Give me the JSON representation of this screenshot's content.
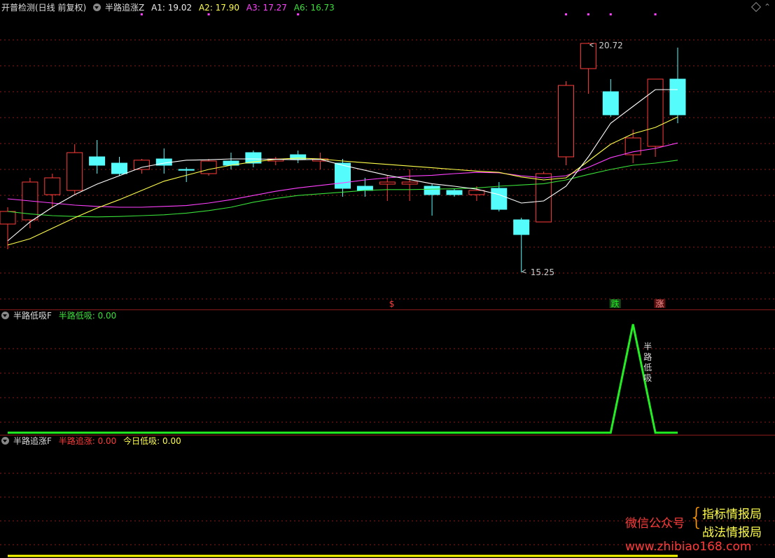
{
  "header": {
    "indicator_name": "开普检测(日线 前复权)",
    "formula_name": "半路追涨Z",
    "A1": "A1: 19.02",
    "A2": "A2: 17.90",
    "A3": "A3: 17.27",
    "A6": "A6: 16.73"
  },
  "panel2": {
    "title": "半路低吸F",
    "series_label": "半路低吸: 0.00"
  },
  "panel3": {
    "title": "半路追涨F",
    "label1": "半路追涨: 0.00",
    "label2": "今日低吸: 0.00"
  },
  "colors": {
    "up": "#ff3b3b",
    "down": "#54fcfc",
    "ma1": "#ffffff",
    "ma2": "#ffff4a",
    "ma3": "#ff40ff",
    "ma4": "#38e038",
    "grid": "#8b1a1a",
    "signal": "#22ee22",
    "yellow": "#ffff00"
  },
  "chart_data": {
    "type": "candlestick",
    "ylim": [
      14.4,
      21.4
    ],
    "annotations": {
      "high": "20.72",
      "low": "15.25"
    },
    "signal_marks": [
      "$",
      "跌",
      "涨"
    ],
    "candles": [
      {
        "o": 16.4,
        "h": 16.8,
        "l": 15.8,
        "c": 16.7
      },
      {
        "o": 16.5,
        "h": 17.5,
        "l": 16.3,
        "c": 17.4
      },
      {
        "o": 17.1,
        "h": 17.6,
        "l": 16.8,
        "c": 17.5
      },
      {
        "o": 17.2,
        "h": 18.3,
        "l": 17.1,
        "c": 18.1
      },
      {
        "o": 18.0,
        "h": 18.4,
        "l": 17.6,
        "c": 17.8
      },
      {
        "o": 17.85,
        "h": 18.0,
        "l": 17.55,
        "c": 17.6
      },
      {
        "o": 17.7,
        "h": 17.95,
        "l": 17.6,
        "c": 17.92
      },
      {
        "o": 17.95,
        "h": 18.2,
        "l": 17.6,
        "c": 17.8
      },
      {
        "o": 17.7,
        "h": 17.75,
        "l": 17.4,
        "c": 17.68
      },
      {
        "o": 17.6,
        "h": 17.95,
        "l": 17.55,
        "c": 17.9
      },
      {
        "o": 17.9,
        "h": 18.1,
        "l": 17.7,
        "c": 17.8
      },
      {
        "o": 18.1,
        "h": 18.15,
        "l": 17.75,
        "c": 17.85
      },
      {
        "o": 17.9,
        "h": 18.0,
        "l": 17.8,
        "c": 17.95
      },
      {
        "o": 18.05,
        "h": 18.15,
        "l": 17.85,
        "c": 17.95
      },
      {
        "o": 17.9,
        "h": 18.1,
        "l": 17.7,
        "c": 17.95
      },
      {
        "o": 17.85,
        "h": 17.95,
        "l": 17.05,
        "c": 17.25
      },
      {
        "o": 17.3,
        "h": 17.5,
        "l": 17.05,
        "c": 17.2
      },
      {
        "o": 17.35,
        "h": 17.55,
        "l": 16.95,
        "c": 17.4
      },
      {
        "o": 17.35,
        "h": 17.7,
        "l": 16.95,
        "c": 17.4
      },
      {
        "o": 17.3,
        "h": 17.35,
        "l": 16.6,
        "c": 17.1
      },
      {
        "o": 17.2,
        "h": 17.25,
        "l": 17.05,
        "c": 17.1
      },
      {
        "o": 17.1,
        "h": 17.3,
        "l": 16.95,
        "c": 17.2
      },
      {
        "o": 17.25,
        "h": 17.4,
        "l": 16.7,
        "c": 16.75
      },
      {
        "o": 16.5,
        "h": 16.55,
        "l": 15.25,
        "c": 16.15
      },
      {
        "o": 16.45,
        "h": 17.65,
        "l": 16.45,
        "c": 17.6
      },
      {
        "o": 18.0,
        "h": 19.8,
        "l": 17.8,
        "c": 19.7
      },
      {
        "o": 20.1,
        "h": 20.72,
        "l": 19.5,
        "c": 20.7
      },
      {
        "o": 19.55,
        "h": 19.85,
        "l": 18.95,
        "c": 19.0
      },
      {
        "o": 18.05,
        "h": 18.65,
        "l": 17.85,
        "c": 18.45
      },
      {
        "o": 18.25,
        "h": 19.85,
        "l": 18.0,
        "c": 19.85
      },
      {
        "o": 19.85,
        "h": 20.6,
        "l": 18.8,
        "c": 19.0
      }
    ],
    "ma1": [
      16.0,
      16.45,
      16.8,
      17.1,
      17.35,
      17.55,
      17.75,
      17.85,
      17.92,
      17.93,
      17.95,
      17.95,
      17.94,
      17.93,
      17.94,
      17.8,
      17.68,
      17.56,
      17.46,
      17.36,
      17.3,
      17.23,
      17.1,
      16.9,
      16.95,
      17.3,
      18.0,
      18.8,
      19.2,
      19.6,
      19.6
    ],
    "ma2": [
      15.9,
      16.05,
      16.3,
      16.55,
      16.78,
      16.98,
      17.2,
      17.42,
      17.56,
      17.7,
      17.8,
      17.88,
      17.94,
      17.97,
      17.95,
      17.9,
      17.86,
      17.82,
      17.78,
      17.74,
      17.7,
      17.66,
      17.63,
      17.52,
      17.45,
      17.5,
      17.9,
      18.3,
      18.55,
      18.7,
      18.95
    ],
    "ma3": [
      17.0,
      16.95,
      16.9,
      16.85,
      16.82,
      16.8,
      16.8,
      16.82,
      16.84,
      16.9,
      16.98,
      17.08,
      17.18,
      17.26,
      17.32,
      17.38,
      17.45,
      17.5,
      17.54,
      17.56,
      17.6,
      17.63,
      17.62,
      17.55,
      17.5,
      17.55,
      17.75,
      17.98,
      18.12,
      18.2,
      18.33
    ],
    "ma4": [
      16.7,
      16.64,
      16.6,
      16.58,
      16.57,
      16.58,
      16.6,
      16.62,
      16.66,
      16.72,
      16.8,
      16.92,
      17.01,
      17.08,
      17.12,
      17.16,
      17.2,
      17.22,
      17.22,
      17.23,
      17.24,
      17.26,
      17.3,
      17.33,
      17.36,
      17.45,
      17.58,
      17.7,
      17.8,
      17.85,
      17.92
    ],
    "low_signal": [
      0,
      0,
      0,
      0,
      0,
      0,
      0,
      0,
      0,
      0,
      0,
      0,
      0,
      0,
      0,
      0,
      0,
      0,
      0,
      0,
      0,
      0,
      0,
      0,
      0,
      0,
      0,
      0,
      1,
      0,
      0
    ],
    "low_signal_label": "半路低吸"
  },
  "watermark": {
    "wechat": "微信公众号",
    "brand1": "指标情报局",
    "brand2": "战法情报局",
    "url": "www.zhibiao168.com"
  }
}
